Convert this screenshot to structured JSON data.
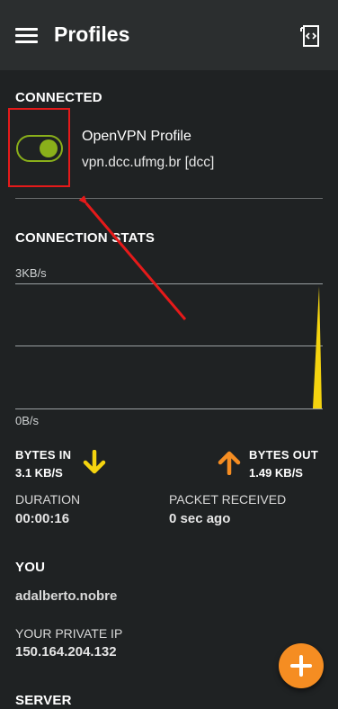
{
  "appbar": {
    "title": "Profiles",
    "menu_icon": "hamburger-menu-icon",
    "import_icon": "import-profile-icon"
  },
  "connected": {
    "section_label": "CONNECTED",
    "toggle_on": true,
    "profile_name": "OpenVPN Profile",
    "profile_server": "vpn.dcc.ufmg.br [dcc]"
  },
  "stats": {
    "section_label": "CONNECTION STATS",
    "graph_top_label": "3KB/s",
    "graph_bottom_label": "0B/s",
    "bytes_in_label": "BYTES IN",
    "bytes_in_value": "3.1 KB/S",
    "bytes_out_label": "BYTES OUT",
    "bytes_out_value": "1.49 KB/S",
    "duration_label": "DURATION",
    "duration_value": "00:00:16",
    "packet_label": "PACKET RECEIVED",
    "packet_value": "0 sec ago"
  },
  "you": {
    "section_label": "YOU",
    "username": "adalberto.nobre",
    "private_ip_label": "YOUR PRIVATE IP",
    "private_ip": "150.164.204.132"
  },
  "server": {
    "section_label": "SERVER"
  },
  "colors": {
    "accent_green": "#8ab01a",
    "bytes_in": "#f5d40f",
    "bytes_out": "#f58d22",
    "annotation_red": "#e51a1a"
  }
}
